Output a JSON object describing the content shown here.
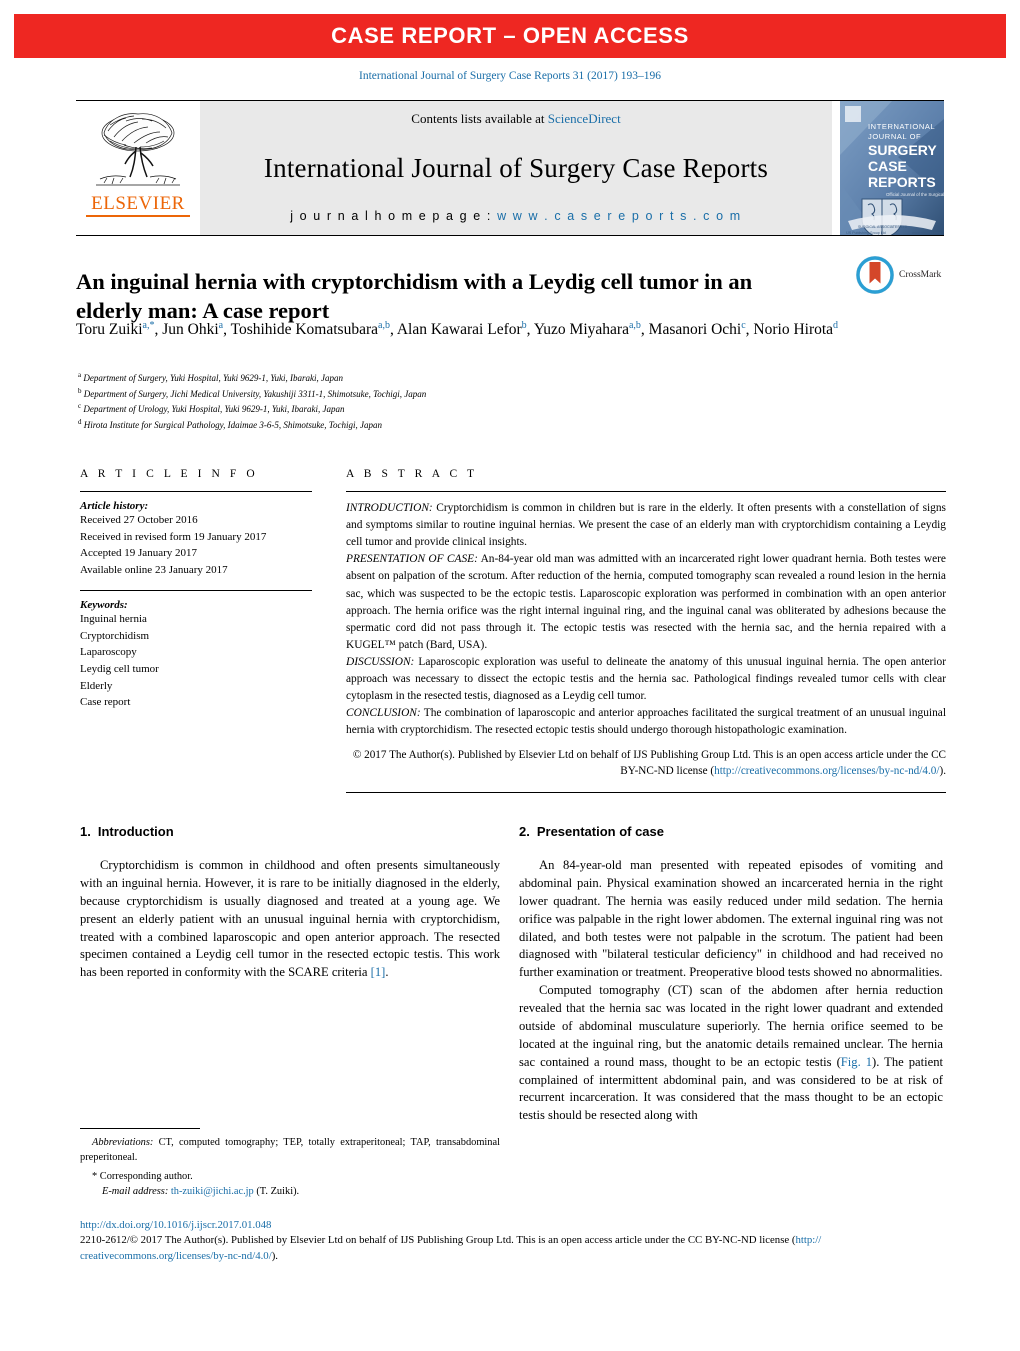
{
  "banner": {
    "text": "CASE REPORT – OPEN ACCESS"
  },
  "citation": "International Journal of Surgery Case Reports 31 (2017) 193–196",
  "journal_header": {
    "contents_prefix": "Contents lists available at ",
    "contents_link": "ScienceDirect",
    "journal_title": "International Journal of Surgery Case Reports",
    "homepage_prefix": "j o u r n a l   h o m e p a g e :  ",
    "homepage_url": "w w w . c a s e r e p o r t s . c o m",
    "publisher": "ELSEVIER",
    "cover_lines": [
      "INTERNATIONAL",
      "JOURNAL OF",
      "SURGERY",
      "CASE",
      "REPORTS"
    ]
  },
  "article": {
    "title": "An inguinal hernia with cryptorchidism with a Leydig cell tumor in an elderly man: A case report",
    "crossmark_label": "CrossMark",
    "authors_html": "Toru Zuiki<sup>a,*</sup>, Jun Ohki<sup>a</sup>, Toshihide Komatsubara<sup>a,b</sup>, Alan Kawarai Lefor<sup>b</sup>, Yuzo Miyahara<sup>a,b</sup>, Masanori Ochi<sup>c</sup>, Norio Hirota<sup>d</sup>",
    "affiliations": [
      {
        "mark": "a",
        "text": "Department of Surgery, Yuki Hospital, Yuki 9629-1, Yuki, Ibaraki, Japan"
      },
      {
        "mark": "b",
        "text": "Department of Surgery, Jichi Medical University, Yakushiji 3311-1, Shimotsuke, Tochigi, Japan"
      },
      {
        "mark": "c",
        "text": "Department of Urology, Yuki Hospital, Yuki 9629-1, Yuki, Ibaraki, Japan"
      },
      {
        "mark": "d",
        "text": "Hirota Institute for Surgical Pathology, Idaimae 3-6-5, Shimotsuke, Tochigi, Japan"
      }
    ]
  },
  "article_info": {
    "heading": "A R T I C L E   I N F O",
    "history_title": "Article history:",
    "history": [
      "Received 27 October 2016",
      "Received in revised form 19 January 2017",
      "Accepted 19 January 2017",
      "Available online 23 January 2017"
    ],
    "keywords_title": "Keywords:",
    "keywords": [
      "Inguinal hernia",
      "Cryptorchidism",
      "Laparoscopy",
      "Leydig cell tumor",
      "Elderly",
      "Case report"
    ]
  },
  "abstract": {
    "heading": "A B S T R A C T",
    "sections": [
      {
        "label": "INTRODUCTION:",
        "text": " Cryptorchidism is common in children but is rare in the elderly. It often presents with a constellation of signs and symptoms similar to routine inguinal hernias. We present the case of an elderly man with cryptorchidism containing a Leydig cell tumor and provide clinical insights."
      },
      {
        "label": "PRESENTATION OF CASE:",
        "text": " An-84-year old man was admitted with an incarcerated right lower quadrant hernia. Both testes were absent on palpation of the scrotum. After reduction of the hernia, computed tomography scan revealed a round lesion in the hernia sac, which was suspected to be the ectopic testis. Laparoscopic exploration was performed in combination with an open anterior approach. The hernia orifice was the right internal inguinal ring, and the inguinal canal was obliterated by adhesions because the spermatic cord did not pass through it. The ectopic testis was resected with the hernia sac, and the hernia repaired with a KUGEL™ patch (Bard, USA)."
      },
      {
        "label": "DISCUSSION:",
        "text": " Laparoscopic exploration was useful to delineate the anatomy of this unusual inguinal hernia. The open anterior approach was necessary to dissect the ectopic testis and the hernia sac. Pathological findings revealed tumor cells with clear cytoplasm in the resected testis, diagnosed as a Leydig cell tumor."
      },
      {
        "label": "CONCLUSION:",
        "text": " The combination of laparoscopic and anterior approaches facilitated the surgical treatment of an unusual inguinal hernia with cryptorchidism. The resected ectopic testis should undergo thorough histopathologic examination."
      }
    ],
    "copyright_pre": "© 2017 The Author(s). Published by Elsevier Ltd on behalf of IJS Publishing Group Ltd. This is an open access article under the CC BY-NC-ND license (",
    "copyright_link": "http://creativecommons.org/licenses/by-nc-nd/4.0/",
    "copyright_post": ")."
  },
  "body": {
    "left": {
      "section_number": "1.",
      "section_title": "Introduction",
      "paragraph_pre": "Cryptorchidism is common in childhood and often presents simultaneously with an inguinal hernia. However, it is rare to be initially diagnosed in the elderly, because cryptorchidism is usually diagnosed and treated at a young age. We present an elderly patient with an unusual inguinal hernia with cryptorchidism, treated with a combined laparoscopic and open anterior approach. The resected specimen contained a Leydig cell tumor in the resected ectopic testis. This work has been reported in conformity with the SCARE criteria ",
      "citation_ref": "[1]",
      "paragraph_post": "."
    },
    "right": {
      "section_number": "2.",
      "section_title": "Presentation of case",
      "paragraph_1": "An 84-year-old man presented with repeated episodes of vomiting and abdominal pain. Physical examination showed an incarcerated hernia in the right lower quadrant. The hernia was easily reduced under mild sedation. The hernia orifice was palpable in the right lower abdomen. The external inguinal ring was not dilated, and both testes were not palpable in the scrotum. The patient had been diagnosed with \"bilateral testicular deficiency\" in childhood and had received no further examination or treatment. Preoperative blood tests showed no abnormalities.",
      "paragraph_2_pre": "Computed tomography (CT) scan of the abdomen after hernia reduction revealed that the hernia sac was located in the right lower quadrant and extended outside of abdominal musculature superiorly. The hernia orifice seemed to be located at the inguinal ring, but the anatomic details remained unclear. The hernia sac contained a round mass, thought to be an ectopic testis (",
      "figure_ref": "Fig. 1",
      "paragraph_2_post": "). The patient complained of intermittent abdominal pain, and was considered to be at risk of recurrent incarceration. It was considered that the mass thought to be an ectopic testis should be resected along with"
    }
  },
  "footnotes": {
    "abbrev_label": "Abbreviations:",
    "abbrev_text": "  CT, computed tomography; TEP, totally extraperitoneal; TAP, transabdominal preperitoneal.",
    "corresponding": "* Corresponding author.",
    "email_label": "E-mail address:",
    "email": "th-zuiki@jichi.ac.jp",
    "email_suffix": " (T. Zuiki)."
  },
  "bottom": {
    "doi": "http://dx.doi.org/10.1016/j.ijscr.2017.01.048",
    "issn_pre": "2210-2612/© 2017 The Author(s). Published by Elsevier Ltd on behalf of IJS Publishing Group Ltd. This is an open access article under the CC BY-NC-ND license (",
    "issn_link_a": "http://",
    "issn_link_b": "creativecommons.org/licenses/by-nc-nd/4.0/",
    "issn_post": ")."
  },
  "colors": {
    "banner_red": "#ee2722",
    "link_blue": "#1a6ea8",
    "elsevier_orange": "#ec6608"
  }
}
